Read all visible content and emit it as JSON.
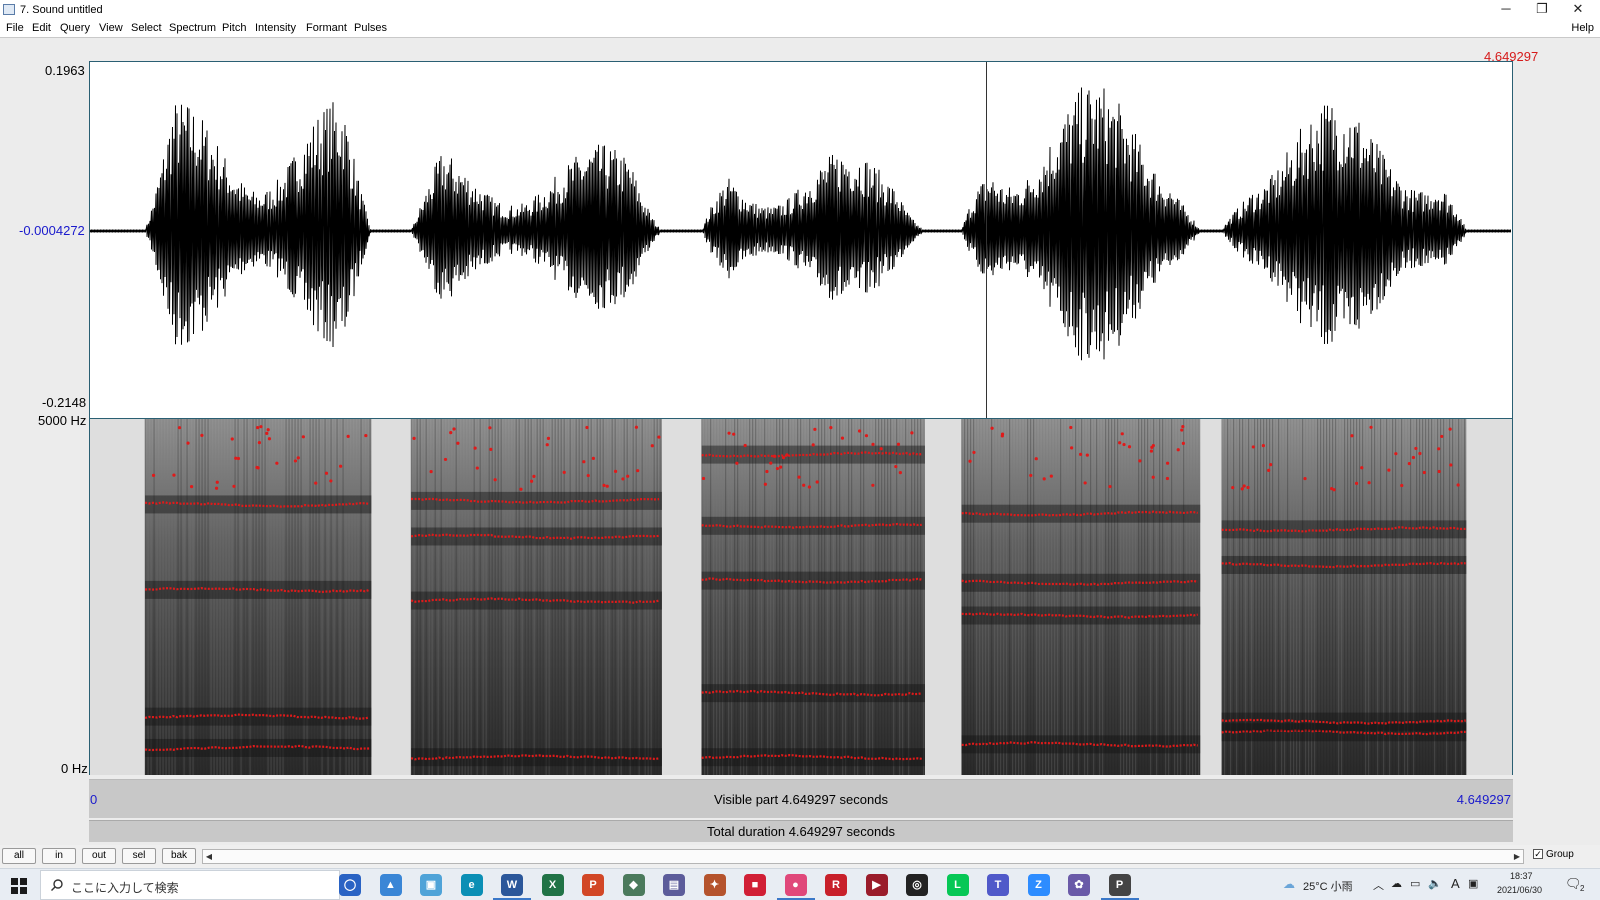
{
  "window": {
    "title": "7. Sound untitled",
    "minimize_glyph": "─",
    "restore_glyph": "❐",
    "close_glyph": "✕"
  },
  "menu": {
    "items": [
      "File",
      "Edit",
      "Query",
      "View",
      "Select",
      "Spectrum",
      "Pitch",
      "Intensity",
      "Formant",
      "Pulses"
    ],
    "help": "Help"
  },
  "waveform": {
    "max_label": "0.1963",
    "mid_label": "-0.0004272",
    "min_label": "-0.2148",
    "cursor_time_label": "4.649297",
    "cursor_time_s": 3.02
  },
  "spectrogram": {
    "top_label": "5000 Hz",
    "bottom_label": "0 Hz",
    "freq_range_hz": [
      0,
      5000
    ],
    "formant_color": "#e01a1a"
  },
  "time_axis": {
    "start_label": "0",
    "end_label": "4.649297",
    "visible_part_text": "Visible part 4.649297 seconds",
    "total_duration_text": "Total duration 4.649297 seconds",
    "total_s": 4.649297
  },
  "segments": [
    {
      "start": 0.18,
      "end": 0.92,
      "amp": 0.88,
      "formants_hz": [
        380,
        820,
        2600,
        3800
      ]
    },
    {
      "start": 1.05,
      "end": 1.87,
      "amp": 0.58,
      "formants_hz": [
        250,
        2450,
        3350,
        3850
      ]
    },
    {
      "start": 2.0,
      "end": 2.73,
      "amp": 0.55,
      "formants_hz": [
        250,
        1150,
        2730,
        3500,
        4500
      ]
    },
    {
      "start": 2.85,
      "end": 3.63,
      "amp": 1.0,
      "formants_hz": [
        430,
        2240,
        2700,
        3670
      ]
    },
    {
      "start": 3.7,
      "end": 4.5,
      "amp": 0.9,
      "formants_hz": [
        600,
        750,
        2950,
        3450
      ]
    }
  ],
  "zoom_buttons": [
    "all",
    "in",
    "out",
    "sel",
    "bak"
  ],
  "group": {
    "label": "Group",
    "checked": true
  },
  "taskbar": {
    "search_placeholder": "ここに入力して検索",
    "apps": [
      {
        "name": "cortana",
        "color": "#2a63c4",
        "glyph": "◯"
      },
      {
        "name": "file-explorer",
        "color": "#3a86d6",
        "glyph": "▲"
      },
      {
        "name": "control-panel",
        "color": "#4fa3d8",
        "glyph": "▣"
      },
      {
        "name": "edge",
        "color": "#0b8fb5",
        "glyph": "e"
      },
      {
        "name": "word",
        "color": "#2b579a",
        "glyph": "W"
      },
      {
        "name": "excel",
        "color": "#217346",
        "glyph": "X"
      },
      {
        "name": "powerpoint",
        "color": "#d24726",
        "glyph": "P"
      },
      {
        "name": "app-green",
        "color": "#4b7a5c",
        "glyph": "◆"
      },
      {
        "name": "app-purple",
        "color": "#5c5c9a",
        "glyph": "▤"
      },
      {
        "name": "app-compass",
        "color": "#b5532c",
        "glyph": "✦"
      },
      {
        "name": "app-box",
        "color": "#d11f35",
        "glyph": "■"
      },
      {
        "name": "app-pink",
        "color": "#e0487a",
        "glyph": "●"
      },
      {
        "name": "app-r",
        "color": "#c8202a",
        "glyph": "R"
      },
      {
        "name": "app-film",
        "color": "#9a1c2a",
        "glyph": "▶"
      },
      {
        "name": "app-disc",
        "color": "#222222",
        "glyph": "◎"
      },
      {
        "name": "line",
        "color": "#06c755",
        "glyph": "L"
      },
      {
        "name": "teams",
        "color": "#5059c9",
        "glyph": "T"
      },
      {
        "name": "zoom",
        "color": "#2d8cff",
        "glyph": "Z"
      },
      {
        "name": "app-flower",
        "color": "#6a5aa8",
        "glyph": "✿"
      },
      {
        "name": "praat",
        "color": "#444444",
        "glyph": "P"
      }
    ],
    "weather": "25°C  小雨",
    "ime": "A",
    "time": "18:37",
    "date": "2021/06/30",
    "notification_count": "2"
  }
}
